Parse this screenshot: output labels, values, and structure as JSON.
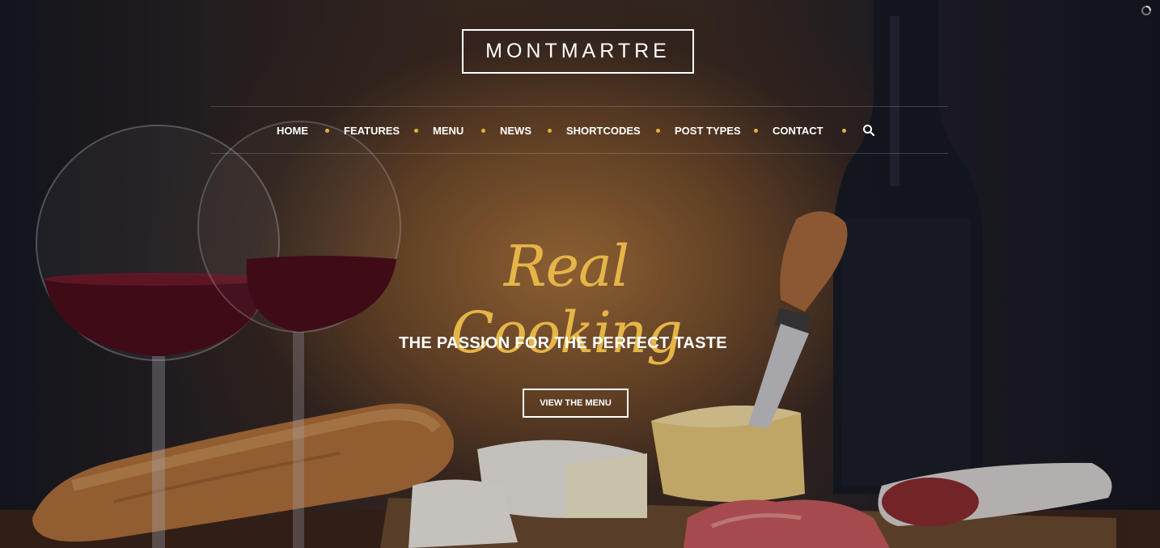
{
  "brand": {
    "logo_text": "MONTMARTRE"
  },
  "nav": {
    "items": [
      {
        "label": "HOME"
      },
      {
        "label": "FEATURES"
      },
      {
        "label": "MENU"
      },
      {
        "label": "NEWS"
      },
      {
        "label": "SHORTCODES"
      },
      {
        "label": "POST TYPES"
      },
      {
        "label": "CONTACT"
      }
    ],
    "search_icon": "search-icon"
  },
  "hero": {
    "headline": "Real Cooking",
    "subheadline": "THE PASSION FOR THE PERFECT TASTE",
    "cta_label": "VIEW THE MENU",
    "background": "wine-cheese-bread-still-life"
  },
  "colors": {
    "accent": "#e6b548",
    "nav_dot": "#e3b23c",
    "text": "#ffffff",
    "wine": "#5a0f1c"
  }
}
